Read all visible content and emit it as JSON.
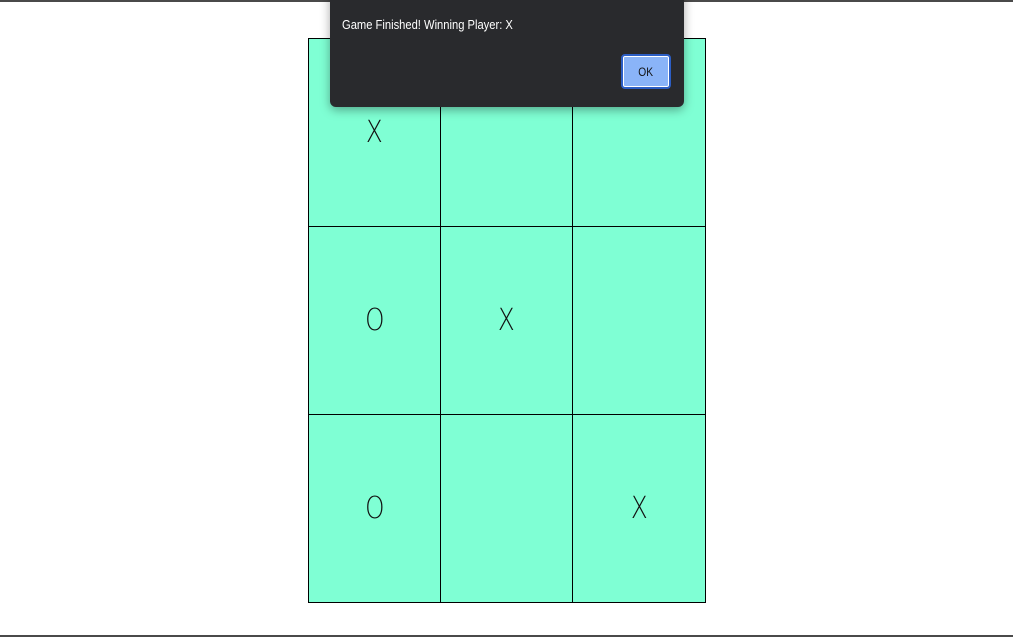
{
  "game": {
    "board": [
      [
        "X",
        "",
        ""
      ],
      [
        "O",
        "X",
        ""
      ],
      [
        "O",
        "",
        "X"
      ]
    ],
    "colors": {
      "cell_background": "#7fffd4",
      "grid_line": "#000000",
      "dialog_background": "#292a2d",
      "dialog_button": "#8ab4f8"
    }
  },
  "dialog": {
    "origin_text": "",
    "message": "Game Finished! Winning Player: X",
    "ok_label": "OK"
  }
}
